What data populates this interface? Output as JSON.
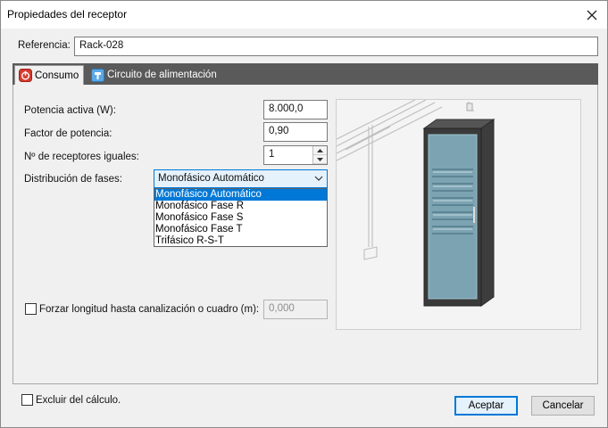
{
  "window": {
    "title": "Propiedades del receptor"
  },
  "referencia": {
    "label": "Referencia:",
    "value": "Rack-028"
  },
  "tabs": [
    {
      "label": "Consumo",
      "icon": "power-icon",
      "active": true
    },
    {
      "label": "Circuito de alimentación",
      "icon": "supply-circuit-icon",
      "active": false
    }
  ],
  "consumo": {
    "potencia_label": "Potencia activa (W):",
    "potencia_value": "8.000,0",
    "factor_label": "Factor de potencia:",
    "factor_value": "0,90",
    "receptores_label": "Nº de receptores iguales:",
    "receptores_value": "1",
    "distribucion_label": "Distribución de fases:",
    "distribucion_selected": "Monofásico Automático",
    "distribucion_options": [
      "Monofásico Automático",
      "Monofásico Fase R",
      "Monofásico Fase S",
      "Monofásico Fase T",
      "Trifásico R-S-T"
    ],
    "forzar_label": "Forzar longitud hasta canalización o cuadro (m):",
    "forzar_value": "0,000"
  },
  "footer": {
    "excluir_label": "Excluir del cálculo.",
    "aceptar_label": "Aceptar",
    "cancelar_label": "Cancelar"
  },
  "colors": {
    "accent": "#0078d7",
    "tabstrip": "#5a5a5a",
    "rack_glass": "#7fa9b8"
  }
}
